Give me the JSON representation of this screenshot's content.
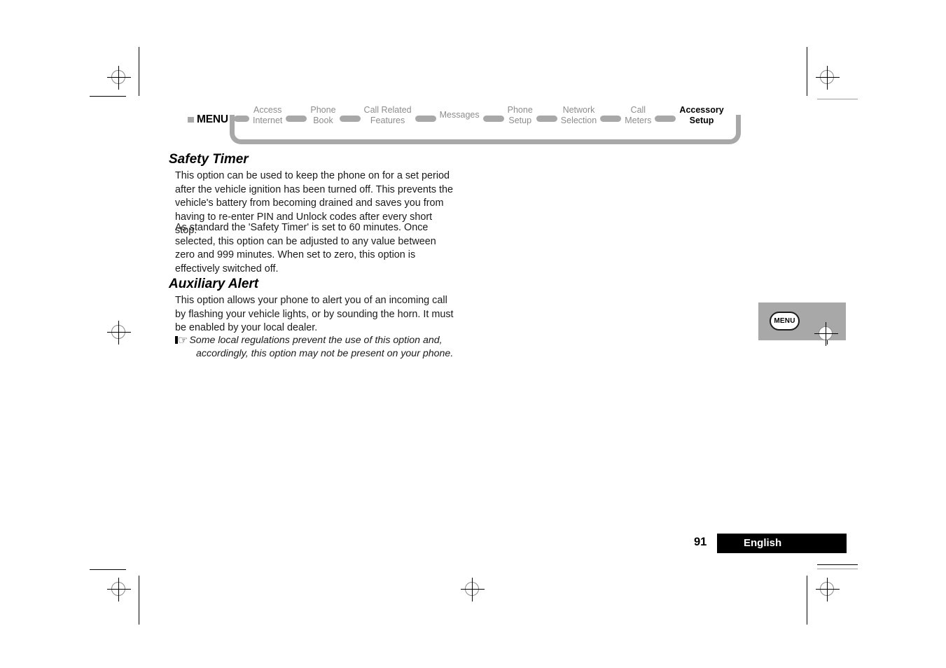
{
  "document": {
    "page_number": "91",
    "language_label": "English"
  },
  "breadcrumb": {
    "root_label": "MENU",
    "root_marker_icon": "square-marker-icon",
    "items": [
      {
        "line1": "Access",
        "line2": "Internet",
        "active": false
      },
      {
        "line1": "Phone",
        "line2": "Book",
        "active": false
      },
      {
        "line1": "Call Related",
        "line2": "Features",
        "active": false
      },
      {
        "line1": "Messages",
        "line2": "",
        "active": false
      },
      {
        "line1": "Phone",
        "line2": "Setup",
        "active": false
      },
      {
        "line1": "Network",
        "line2": "Selection",
        "active": false
      },
      {
        "line1": "Call",
        "line2": "Meters",
        "active": false
      },
      {
        "line1": "Accessory",
        "line2": "Setup",
        "active": true
      }
    ]
  },
  "sections": [
    {
      "title": "Safety Timer",
      "paragraphs": [
        "This option can be used to keep the phone on for a set period after the vehicle ignition has been turned off. This prevents the vehicle's battery from becoming drained and saves you from having to re-enter PIN and Unlock codes after every short stop.",
        "As standard the 'Safety Timer' is set to 60 minutes. Once selected, this option can be adjusted to any value between zero and 999 minutes. When set to zero, this option is effectively switched off."
      ]
    },
    {
      "title": "Auxiliary Alert",
      "paragraphs": [
        "This option allows your phone to alert you of an incoming call by flashing your vehicle lights, or by sounding the horn. It must be enabled by your local dealer."
      ],
      "note": {
        "icon": "pointing-hand-icon",
        "icon_glyph": "☞",
        "line1": "Some local regulations prevent the use of this option and,",
        "line2": "accordingly, this option may not be present on your phone."
      }
    }
  ],
  "key_callout": {
    "key_label": "MENU"
  },
  "colors": {
    "breadcrumb_gray": "#a8a8a8",
    "breadcrumb_text_gray": "#8d8d8d",
    "active_black": "#000000",
    "callout_bg": "#a8a8a8",
    "footer_bar": "#000000",
    "footer_text": "#ffffff"
  }
}
